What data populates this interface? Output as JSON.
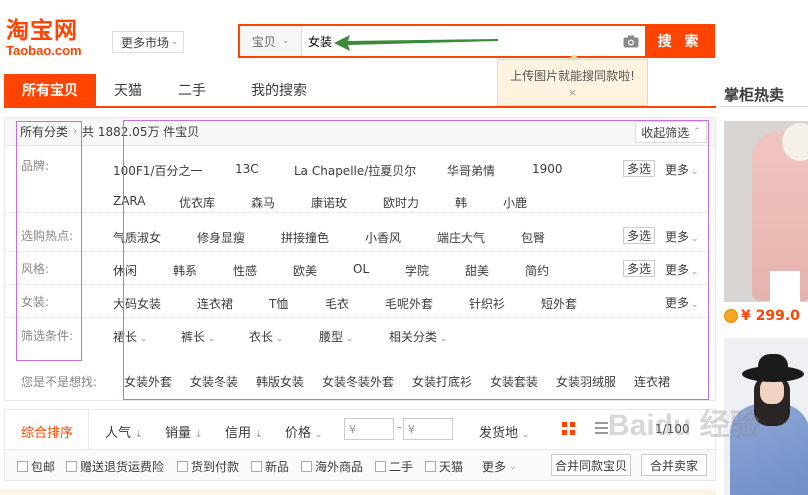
{
  "header": {
    "logo_cn": "淘宝网",
    "logo_en": "Taobao.com",
    "market_label": "更多市场",
    "search_scope": "宝贝",
    "search_value": "女装",
    "search_button": "搜 索",
    "image_search_tip": "上传图片就能搜同款啦!",
    "tip_close": "×"
  },
  "tabs": [
    "所有宝贝",
    "天猫",
    "二手",
    "我的搜索"
  ],
  "right_panel": {
    "title": "掌柜热卖",
    "price": "¥ 299.0"
  },
  "filter": {
    "crumb_root": "所有分类",
    "result_count": "共 1882.05万 件宝贝",
    "collapse_label": "收起筛选",
    "rows": [
      {
        "label": "品牌:",
        "values": [
          "100F1/百分之一",
          "13C",
          "La Chapelle/拉夏贝尔",
          "华哥弟情",
          "1900"
        ],
        "values2": [
          "ZARA",
          "优衣库",
          "森马",
          "康诺玫",
          "欧时力",
          "韩",
          "小鹿"
        ],
        "multi": "多选",
        "more": "更多"
      },
      {
        "label": "选购热点:",
        "values": [
          "气质淑女",
          "修身显瘦",
          "拼接撞色",
          "小香风",
          "端庄大气",
          "包臀"
        ],
        "multi": "多选",
        "more": "更多"
      },
      {
        "label": "风格:",
        "values": [
          "休闲",
          "韩系",
          "性感",
          "欧美",
          "OL",
          "学院",
          "甜美",
          "简约"
        ],
        "multi": "多选",
        "more": "更多"
      },
      {
        "label": "女装:",
        "values": [
          "大码女装",
          "连衣裙",
          "T恤",
          "毛衣",
          "毛呢外套",
          "针织衫",
          "短外套"
        ],
        "more": "更多"
      },
      {
        "label": "筛选条件:",
        "values": [
          "裙长",
          "裤长",
          "衣长",
          "腰型",
          "相关分类"
        ]
      }
    ],
    "suggest_label": "您是不是想找:",
    "suggestions": [
      "女装外套",
      "女装冬装",
      "韩版女装",
      "女装冬装外套",
      "女装打底衫",
      "女装套装",
      "女装羽绒服",
      "连衣裙"
    ]
  },
  "sort": {
    "items": [
      "综合排序",
      "人气",
      "销量",
      "信用",
      "价格"
    ],
    "price_from": "¥",
    "price_to": "¥",
    "price_dash": "-",
    "ship_from": "发货地",
    "pager": "1/100"
  },
  "options": [
    "包邮",
    "赠送退货运费险",
    "货到付款",
    "新品",
    "海外商品",
    "二手",
    "天猫"
  ],
  "options_more": "更多",
  "option_buttons": [
    "合并同款宝贝",
    "合并卖家"
  ],
  "watermark": "Baidu 经验",
  "colors": {
    "accent": "#ff4400",
    "annotation": "#c46fe0",
    "arrow": "#3a8a3a"
  }
}
